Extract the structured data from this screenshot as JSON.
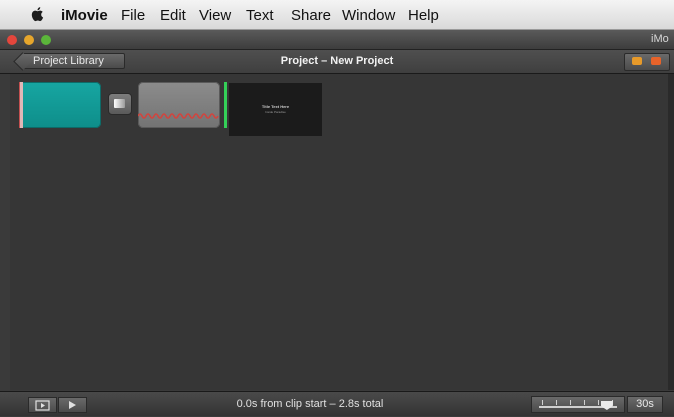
{
  "menubar": {
    "items": [
      "iMovie",
      "File",
      "Edit",
      "View",
      "Text",
      "Share",
      "Window",
      "Help"
    ]
  },
  "titlebar": {
    "window_title": "iMo"
  },
  "toolbar": {
    "back_label": "Project Library",
    "project_title": "Project – New Project"
  },
  "clips": {
    "title_clip": {
      "title": "Title Text Here",
      "subtitle": "Inside Paradise"
    }
  },
  "bottombar": {
    "status": "0.0s from clip start – 2.8s total",
    "zoom_value": "30s",
    "zoom_level": 0.87
  },
  "colors": {
    "accent_teal": "#17a6a2",
    "green_marker": "#34d058",
    "wave_red": "#d0453f"
  }
}
